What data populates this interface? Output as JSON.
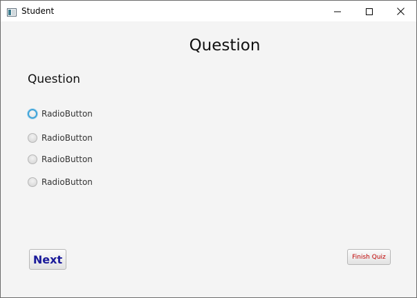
{
  "window": {
    "title": "Student",
    "icon": "java-app-icon"
  },
  "title_bar_buttons": {
    "minimize_icon": "minimize-icon",
    "maximize_icon": "maximize-icon",
    "close_icon": "close-icon"
  },
  "main": {
    "page_title": "Question",
    "question_text": "Question",
    "options": [
      {
        "label": "RadioButton",
        "selected": false,
        "focused": true
      },
      {
        "label": "RadioButton",
        "selected": false,
        "focused": false
      },
      {
        "label": "RadioButton",
        "selected": false,
        "focused": false
      },
      {
        "label": "RadioButton",
        "selected": false,
        "focused": false
      }
    ]
  },
  "buttons": {
    "next_label": "Next",
    "finish_label": "Finish Quiz"
  },
  "colors": {
    "background": "#f4f4f4",
    "focus_ring": "#3ea3d8",
    "next_text": "#1a1a9a",
    "finish_text": "#c00000"
  }
}
